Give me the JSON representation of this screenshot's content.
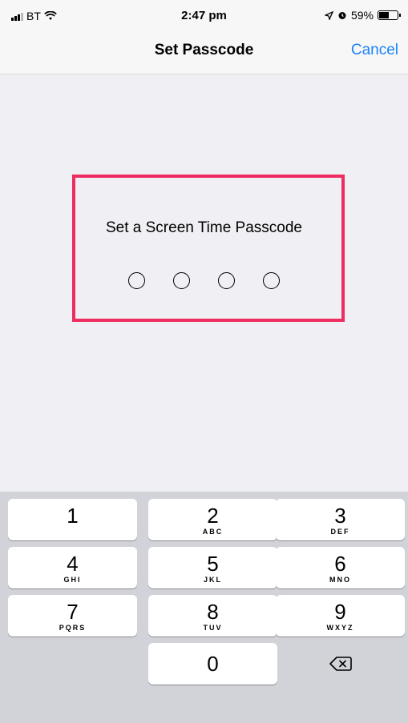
{
  "status_bar": {
    "carrier": "BT",
    "time": "2:47 pm",
    "battery": "59%",
    "battery_level": 0.59
  },
  "nav": {
    "title": "Set Passcode",
    "cancel_label": "Cancel"
  },
  "prompt": "Set a Screen Time Passcode",
  "passcode": {
    "length": 4,
    "entered": 0
  },
  "keypad": {
    "keys": [
      {
        "num": "1",
        "letters": ""
      },
      {
        "num": "2",
        "letters": "ABC"
      },
      {
        "num": "3",
        "letters": "DEF"
      },
      {
        "num": "4",
        "letters": "GHI"
      },
      {
        "num": "5",
        "letters": "JKL"
      },
      {
        "num": "6",
        "letters": "MNO"
      },
      {
        "num": "7",
        "letters": "PQRS"
      },
      {
        "num": "8",
        "letters": "TUV"
      },
      {
        "num": "9",
        "letters": "WXYZ"
      },
      {
        "num": "0",
        "letters": ""
      }
    ],
    "delete_icon": "delete-backspace-icon"
  },
  "colors": {
    "accent": "#1a82fb",
    "highlight_border": "#ee2c5f",
    "background": "#efeff4",
    "keypad_bg": "#d1d3d9"
  }
}
